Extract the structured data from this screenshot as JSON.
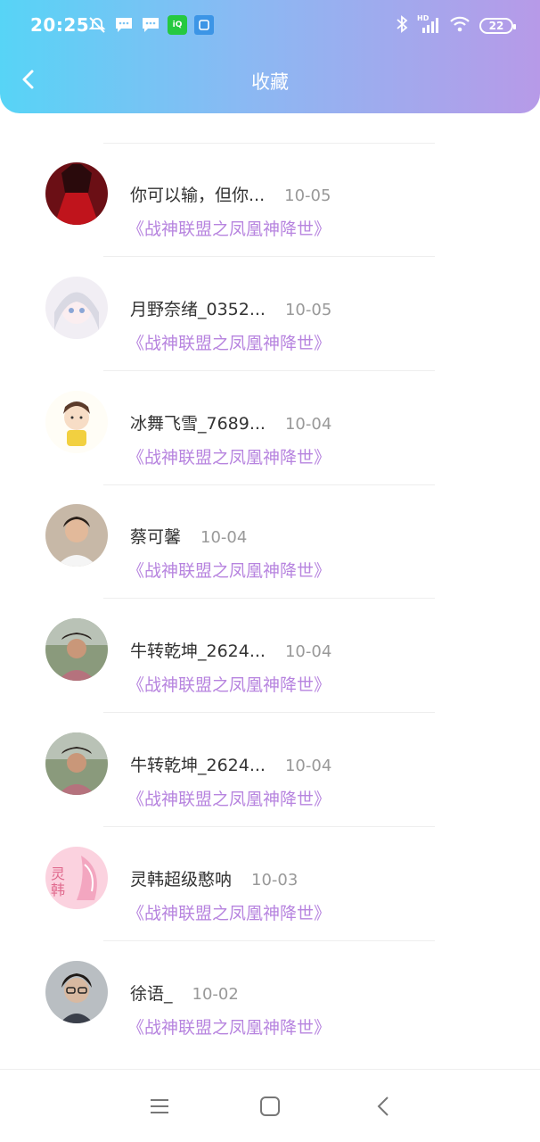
{
  "status_bar": {
    "time": "20:25",
    "battery": "22",
    "left_icons": [
      "alarm-off-icon",
      "message-icon",
      "message-icon",
      "iqiyi-icon",
      "app-icon"
    ],
    "right_icons": [
      "bluetooth-icon",
      "signal-icon",
      "wifi-icon",
      "battery-icon"
    ],
    "network_badge": "HD"
  },
  "header": {
    "title": "收藏",
    "back_icon": "chevron-left-icon",
    "gradient_start": "#57d4f6",
    "gradient_end": "#b79ae8"
  },
  "items": [
    {
      "name": "你可以输，但你...",
      "date": "10-05",
      "book": "《战神联盟之凤凰神降世》",
      "avatar": "red"
    },
    {
      "name": "月野奈绪_0352...",
      "date": "10-05",
      "book": "《战神联盟之凤凰神降世》",
      "avatar": "pale"
    },
    {
      "name": "冰舞飞雪_7689...",
      "date": "10-04",
      "book": "《战神联盟之凤凰神降世》",
      "avatar": "cartoon"
    },
    {
      "name": "蔡可馨",
      "date": "10-04",
      "book": "《战神联盟之凤凰神降世》",
      "avatar": "kid"
    },
    {
      "name": "牛转乾坤_2624...",
      "date": "10-04",
      "book": "《战神联盟之凤凰神降世》",
      "avatar": "photo"
    },
    {
      "name": "牛转乾坤_2624...",
      "date": "10-04",
      "book": "《战神联盟之凤凰神降世》",
      "avatar": "photo"
    },
    {
      "name": "灵韩超级憨呐",
      "date": "10-03",
      "book": "《战神联盟之凤凰神降世》",
      "avatar": "pink",
      "avatar_text": "灵韩"
    },
    {
      "name": "徐语_",
      "date": "10-02",
      "book": "《战神联盟之凤凰神降世》",
      "avatar": "glasses"
    }
  ],
  "colors": {
    "book_title": "#b784df",
    "date": "#999999",
    "name": "#333333"
  },
  "bottom_nav": [
    "menu-icon",
    "home-square-icon",
    "back-triangle-icon"
  ]
}
